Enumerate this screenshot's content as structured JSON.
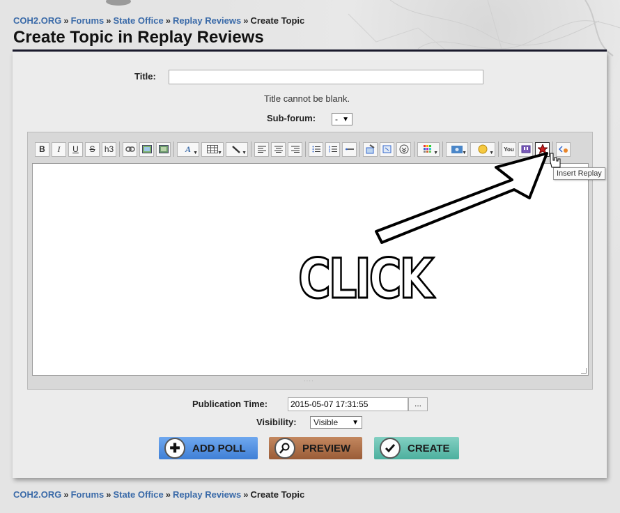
{
  "breadcrumb": {
    "items": [
      "COH2.ORG",
      "Forums",
      "State Office",
      "Replay Reviews"
    ],
    "separator": "»",
    "current": "Create Topic"
  },
  "page_title": "Create Topic in Replay Reviews",
  "form": {
    "title_label": "Title:",
    "title_value": "",
    "title_error": "Title cannot be blank.",
    "subforum_label": "Sub-forum:",
    "subforum_value": "-",
    "publication_label": "Publication Time:",
    "publication_value": "2015-05-07 17:31:55",
    "publication_button": "...",
    "visibility_label": "Visibility:",
    "visibility_value": "Visible"
  },
  "toolbar": {
    "bold": "B",
    "italic": "I",
    "underline": "U",
    "strike": "S",
    "heading": "h3",
    "youtube": "You"
  },
  "tooltip": "Insert Replay",
  "annotation": "CLICK",
  "actions": {
    "add_poll": "ADD POLL",
    "preview": "PREVIEW",
    "create": "CREATE"
  },
  "colors": {
    "link": "#3a6aa8",
    "poll_button": "#4f8ee2",
    "preview_button": "#a9683f",
    "create_button": "#5bbfad",
    "title_rule": "#1b1b2e"
  }
}
